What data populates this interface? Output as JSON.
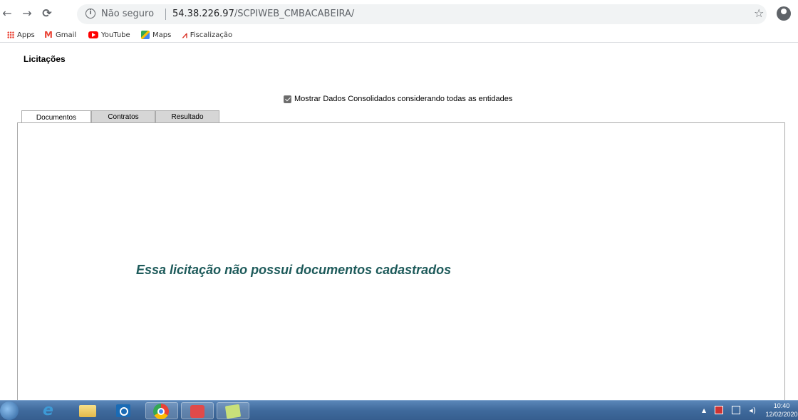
{
  "browser": {
    "security_label": "Não seguro",
    "url_host": "54.38.226.97",
    "url_path": "/SCPIWEB_CMBACABEIRA/",
    "bookmarks": [
      {
        "label": "Apps",
        "icon": "apps-icon"
      },
      {
        "label": "Gmail",
        "icon": "gmail-icon"
      },
      {
        "label": "YouTube",
        "icon": "youtube-icon"
      },
      {
        "label": "Maps",
        "icon": "maps-icon"
      },
      {
        "label": "Fiscalização",
        "icon": "fiscalizacao-icon"
      }
    ]
  },
  "page": {
    "title": "Licitações",
    "consolidated_checkbox": {
      "label": "Mostrar Dados Consolidados considerando todas as entidades",
      "checked": true
    },
    "tabs": [
      {
        "label": "Documentos",
        "active": true
      },
      {
        "label": "Contratos",
        "active": false
      },
      {
        "label": "Resultado",
        "active": false
      }
    ],
    "empty_message": "Essa licitação não possui documentos cadastrados"
  },
  "taskbar": {
    "clock_time": "10:40",
    "clock_date": "12/02/2020"
  }
}
